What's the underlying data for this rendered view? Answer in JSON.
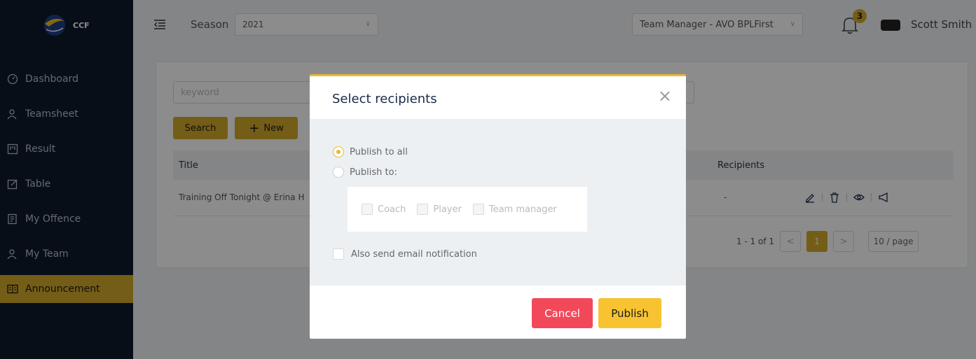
{
  "brand": {
    "name": "CCF"
  },
  "sidebar": {
    "items": [
      {
        "label": "Dashboard",
        "icon": "dashboard-icon"
      },
      {
        "label": "Teamsheet",
        "icon": "users-icon"
      },
      {
        "label": "Result",
        "icon": "result-icon"
      },
      {
        "label": "Table",
        "icon": "edit-icon"
      },
      {
        "label": "My Offence",
        "icon": "document-icon"
      },
      {
        "label": "My Team",
        "icon": "team-icon"
      },
      {
        "label": "Announcement",
        "icon": "book-icon"
      }
    ],
    "active": "Announcement"
  },
  "header": {
    "season_label": "Season",
    "season_value": "2021",
    "team_value": "Team Manager - AVO BPLFirst",
    "notification_count": "3",
    "user_name": "Scott Smith"
  },
  "content": {
    "keyword_placeholder": "keyword",
    "search_label": "Search",
    "new_label": "New",
    "columns": {
      "title": "Title",
      "recipients": "Recipients"
    },
    "rows": [
      {
        "title": "Training Off Tonight @ Erina H",
        "recipients": "-"
      }
    ],
    "pagination": {
      "range": "1 - 1 of 1",
      "current": "1",
      "page_size": "10 / page"
    }
  },
  "modal": {
    "title": "Select recipients",
    "option_all": "Publish to all",
    "option_to": "Publish to:",
    "selected_option": "Publish to all",
    "roles": [
      "Coach",
      "Player",
      "Team manager"
    ],
    "email_label": "Also send email notification",
    "cancel_label": "Cancel",
    "publish_label": "Publish"
  },
  "colors": {
    "sidebar_bg": "#0d1b2a",
    "accent": "#d4aa2b",
    "modal_accent": "#e8b830",
    "cancel": "#f2495a",
    "publish": "#f7c331"
  }
}
